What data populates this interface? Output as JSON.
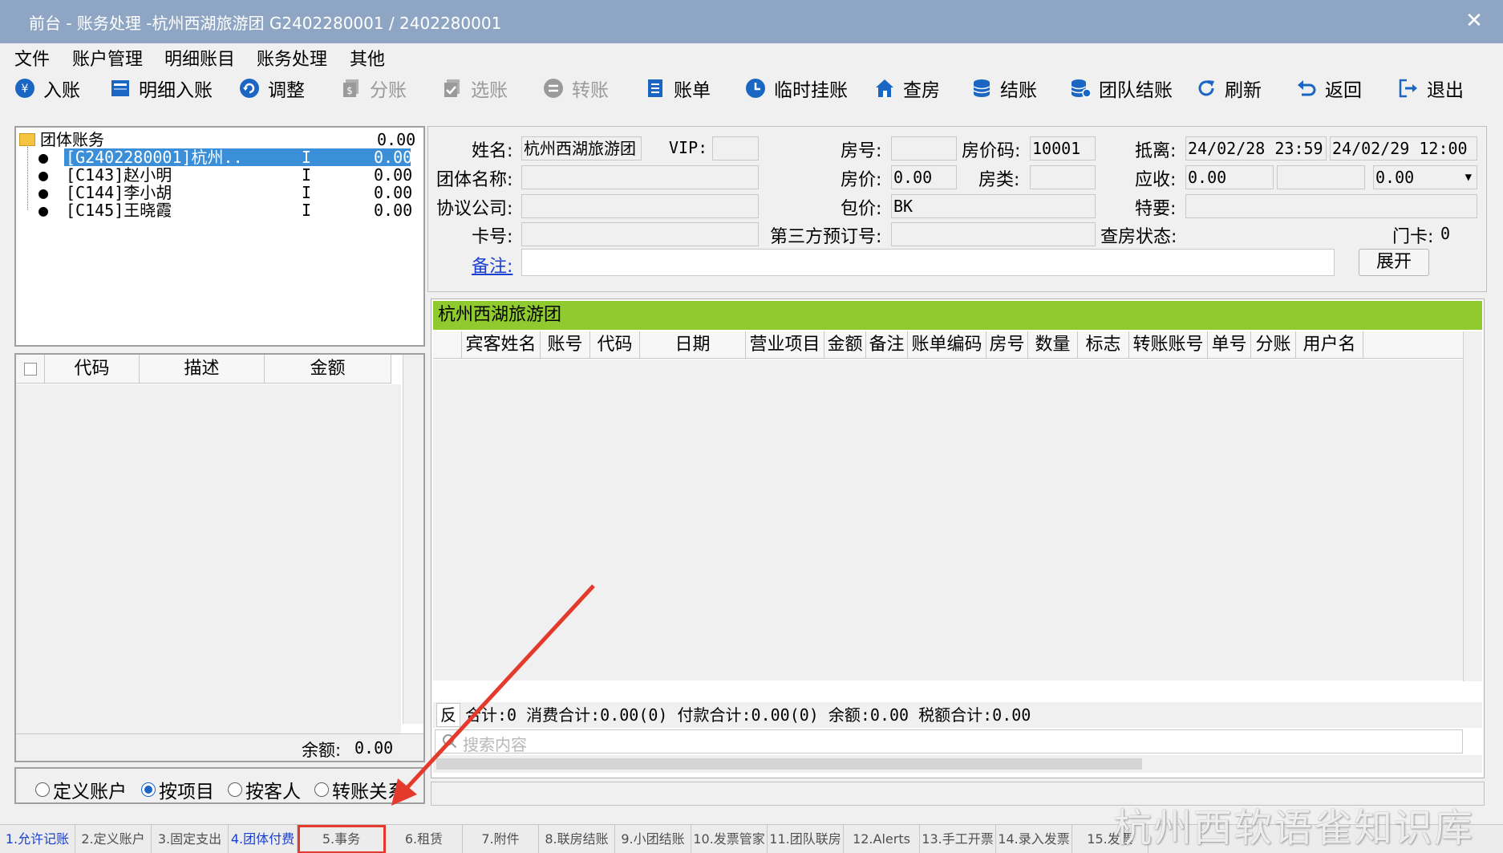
{
  "window": {
    "title": "前台 - 账务处理 -杭州西湖旅游团  G2402280001  /  2402280001",
    "close_glyph": "✕"
  },
  "menu": [
    "文件",
    "账户管理",
    "明细账目",
    "账务处理",
    "其他"
  ],
  "toolbar": [
    {
      "label": "入账",
      "icon": "coin-icon",
      "enabled": true
    },
    {
      "label": "明细入账",
      "icon": "ledger-icon",
      "enabled": true
    },
    {
      "label": "调整",
      "icon": "adjust-icon",
      "enabled": true
    },
    {
      "label": "分账",
      "icon": "split-icon",
      "enabled": false
    },
    {
      "label": "选账",
      "icon": "select-icon",
      "enabled": false
    },
    {
      "label": "转账",
      "icon": "transfer-icon",
      "enabled": false
    },
    {
      "label": "账单",
      "icon": "bill-icon",
      "enabled": true
    },
    {
      "label": "临时挂账",
      "icon": "clock-icon",
      "enabled": true
    },
    {
      "label": "查房",
      "icon": "house-icon",
      "enabled": true
    },
    {
      "label": "结账",
      "icon": "stack-icon",
      "enabled": true
    },
    {
      "label": "团队结账",
      "icon": "stacks-icon",
      "enabled": true
    },
    {
      "label": "刷新",
      "icon": "refresh-icon",
      "enabled": true
    },
    {
      "label": "返回",
      "icon": "back-icon",
      "enabled": true
    },
    {
      "label": "退出",
      "icon": "exit-icon",
      "enabled": true
    }
  ],
  "tree": {
    "root": {
      "label": "团体账务",
      "amount": "0.00"
    },
    "items": [
      {
        "label": "[G2402280001]杭州..",
        "flag": "I",
        "amount": "0.00",
        "selected": true
      },
      {
        "label": "[C143]赵小明",
        "flag": "I",
        "amount": "0.00",
        "selected": false
      },
      {
        "label": "[C144]李小胡",
        "flag": "I",
        "amount": "0.00",
        "selected": false
      },
      {
        "label": "[C145]王晓霞",
        "flag": "I",
        "amount": "0.00",
        "selected": false
      }
    ]
  },
  "left_grid": {
    "columns": [
      "代码",
      "描述",
      "金额"
    ],
    "balance_label": "余额:",
    "balance_value": "0.00"
  },
  "radios": [
    {
      "label": "定义账户",
      "checked": false
    },
    {
      "label": "按项目",
      "checked": true
    },
    {
      "label": "按客人",
      "checked": false
    },
    {
      "label": "转账关系",
      "checked": false
    }
  ],
  "form": {
    "name_label": "姓名:",
    "name_value": "杭州西湖旅游团",
    "vip_label": "VIP:",
    "vip_value": "",
    "room_no_label": "房号:",
    "room_no_value": "",
    "rate_code_label": "房价码:",
    "rate_code_value": "10001",
    "arrive_depart_label": "抵离:",
    "arrive_value": "24/02/28 23:59",
    "depart_value": "24/02/29 12:00",
    "group_name_label": "团体名称:",
    "group_name_value": "",
    "rate_label": "房价:",
    "rate_value": "0.00",
    "room_type_label": "房类:",
    "room_type_value": "",
    "receivable_label": "应收:",
    "receivable_value": "0.00",
    "receivable_mid": "",
    "receivable_select": "0.00",
    "agreement_label": "协议公司:",
    "agreement_value": "",
    "package_label": "包价:",
    "package_value": "BK",
    "special_label": "特要:",
    "special_value": "",
    "card_label": "卡号:",
    "card_value": "",
    "third_party_label": "第三方预订号:",
    "third_party_value": "",
    "checkroom_label": "查房状态:",
    "door_card_label": "门卡:",
    "door_card_value": "0",
    "remark_label": "备注:",
    "remark_value": "",
    "expand_button": "展开"
  },
  "right_grid": {
    "group_band": "杭州西湖旅游团",
    "columns": [
      "宾客姓名",
      "账号",
      "代码",
      "日期",
      "营业项目",
      "金额",
      "备注",
      "账单编码",
      "房号",
      "数量",
      "标志",
      "转账账号",
      "单号",
      "分账",
      "用户名"
    ],
    "reverse_label": "反",
    "summary": "合计:0   消费合计:0.00(0)   付款合计:0.00(0)   余额:0.00   税额合计:0.00",
    "search_placeholder": "搜索内容"
  },
  "tabs": [
    {
      "label": "1.允许记账",
      "color": "blue"
    },
    {
      "label": "2.定义账户",
      "color": "gray"
    },
    {
      "label": "3.固定支出",
      "color": "gray"
    },
    {
      "label": "4.团体付费",
      "color": "blue"
    },
    {
      "label": "5.事务",
      "color": "gray",
      "highlighted": true
    },
    {
      "label": "6.租赁",
      "color": "gray"
    },
    {
      "label": "7.附件",
      "color": "gray"
    },
    {
      "label": "8.联房结账",
      "color": "gray"
    },
    {
      "label": "9.小团结账",
      "color": "gray"
    },
    {
      "label": "10.发票管家",
      "color": "gray"
    },
    {
      "label": "11.团队联房",
      "color": "gray"
    },
    {
      "label": "12.Alerts",
      "color": "gray"
    },
    {
      "label": "13.手工开票",
      "color": "gray"
    },
    {
      "label": "14.录入发票",
      "color": "gray"
    },
    {
      "label": "15.发票",
      "color": "gray"
    }
  ],
  "watermark": "杭州西软语雀知识库",
  "colors": {
    "titlebar": "#8ea6c4",
    "group_band": "#8fcb2f",
    "selection": "#3b8fd9",
    "annotation": "#e43a2b",
    "icon_blue": "#1a66c2"
  }
}
